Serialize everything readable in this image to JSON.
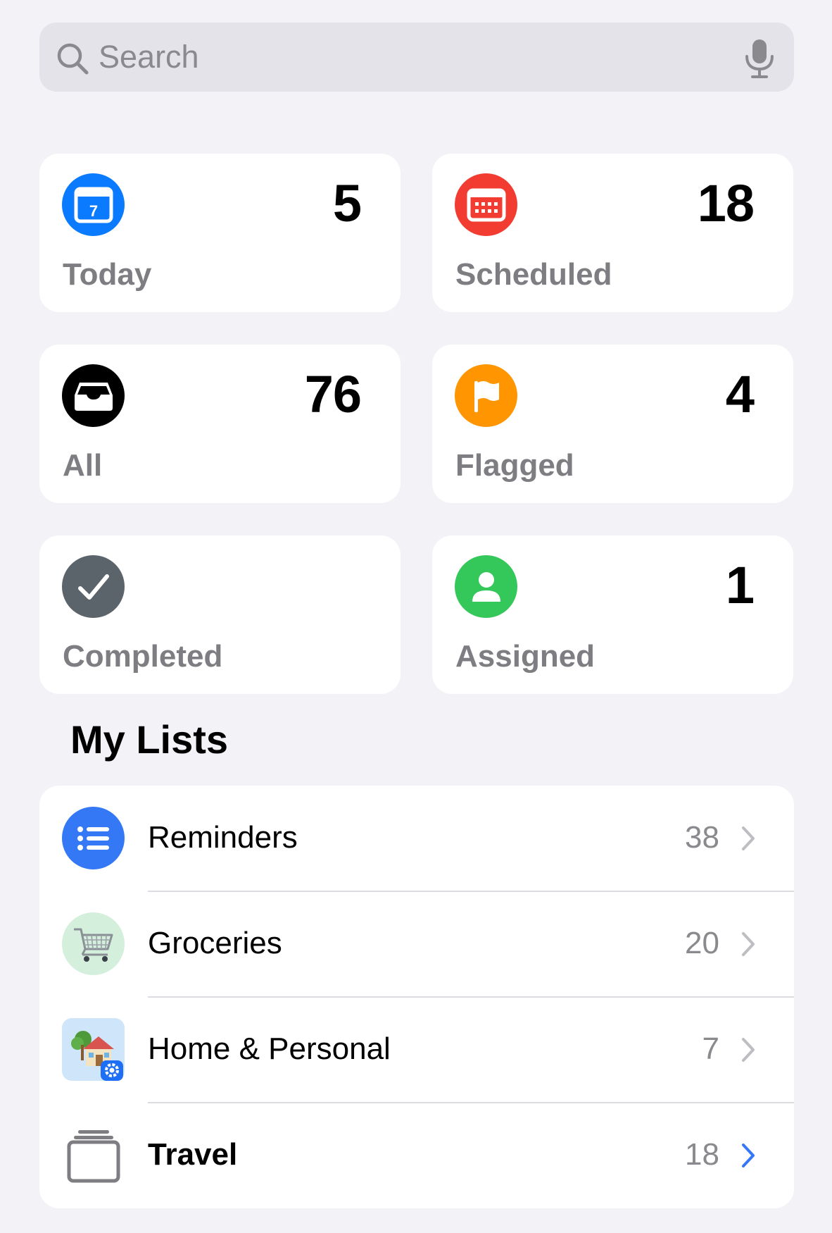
{
  "search": {
    "placeholder": "Search"
  },
  "smart_lists": [
    {
      "label": "Today",
      "count": "5",
      "icon": "calendar-today-icon",
      "color": "#0A7AFF"
    },
    {
      "label": "Scheduled",
      "count": "18",
      "icon": "calendar-scheduled-icon",
      "color": "#F23C31"
    },
    {
      "label": "All",
      "count": "76",
      "icon": "tray-icon",
      "color": "#000000"
    },
    {
      "label": "Flagged",
      "count": "4",
      "icon": "flag-icon",
      "color": "#FF9500"
    },
    {
      "label": "Completed",
      "count": "",
      "icon": "checkmark-icon",
      "color": "#5B636B"
    },
    {
      "label": "Assigned",
      "count": "1",
      "icon": "person-icon",
      "color": "#34C759"
    }
  ],
  "my_lists": {
    "title": "My Lists",
    "items": [
      {
        "name": "Reminders",
        "count": "38",
        "icon": "list-bullet-icon",
        "color": "#3478F6"
      },
      {
        "name": "Groceries",
        "count": "20",
        "icon": "shopping-cart-icon",
        "color": "#D4EFDC"
      },
      {
        "name": "Home & Personal",
        "count": "7",
        "icon": "house-icon",
        "color": "#CFE5FA"
      },
      {
        "name": "Travel",
        "count": "18",
        "icon": "stack-icon",
        "color": "#3478F6"
      }
    ]
  }
}
